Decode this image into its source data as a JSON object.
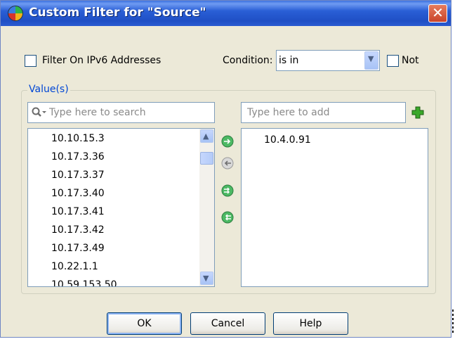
{
  "window": {
    "title": "Custom Filter for \"Source\"",
    "close_glyph": "✕"
  },
  "options": {
    "ipv6_label": "Filter On IPv6 Addresses",
    "ipv6_checked": false,
    "condition_label": "Condition:",
    "condition_value": "is in",
    "not_label": "Not",
    "not_checked": false
  },
  "values_group": {
    "label": "Value(s)",
    "search_placeholder": "Type here to search",
    "add_placeholder": "Type here to add",
    "available": [
      "10.10.15.3",
      "10.17.3.36",
      "10.17.3.37",
      "10.17.3.40",
      "10.17.3.41",
      "10.17.3.42",
      "10.17.3.49",
      "10.22.1.1",
      "10.59.153.50"
    ],
    "selected": [
      "10.4.0.91"
    ]
  },
  "buttons": {
    "ok": "OK",
    "cancel": "Cancel",
    "help": "Help"
  },
  "colors": {
    "title_bar": "#2a5fd6",
    "group_label": "#0046d5",
    "arrow_green": "#3aa655"
  },
  "icons": {
    "app": "filter-app-icon",
    "search": "search-icon",
    "add": "add-plus-icon",
    "move_right": "arrow-right-icon",
    "move_left": "arrow-left-icon",
    "move_all_right": "double-arrow-right-icon",
    "move_all_left": "double-arrow-left-icon"
  }
}
